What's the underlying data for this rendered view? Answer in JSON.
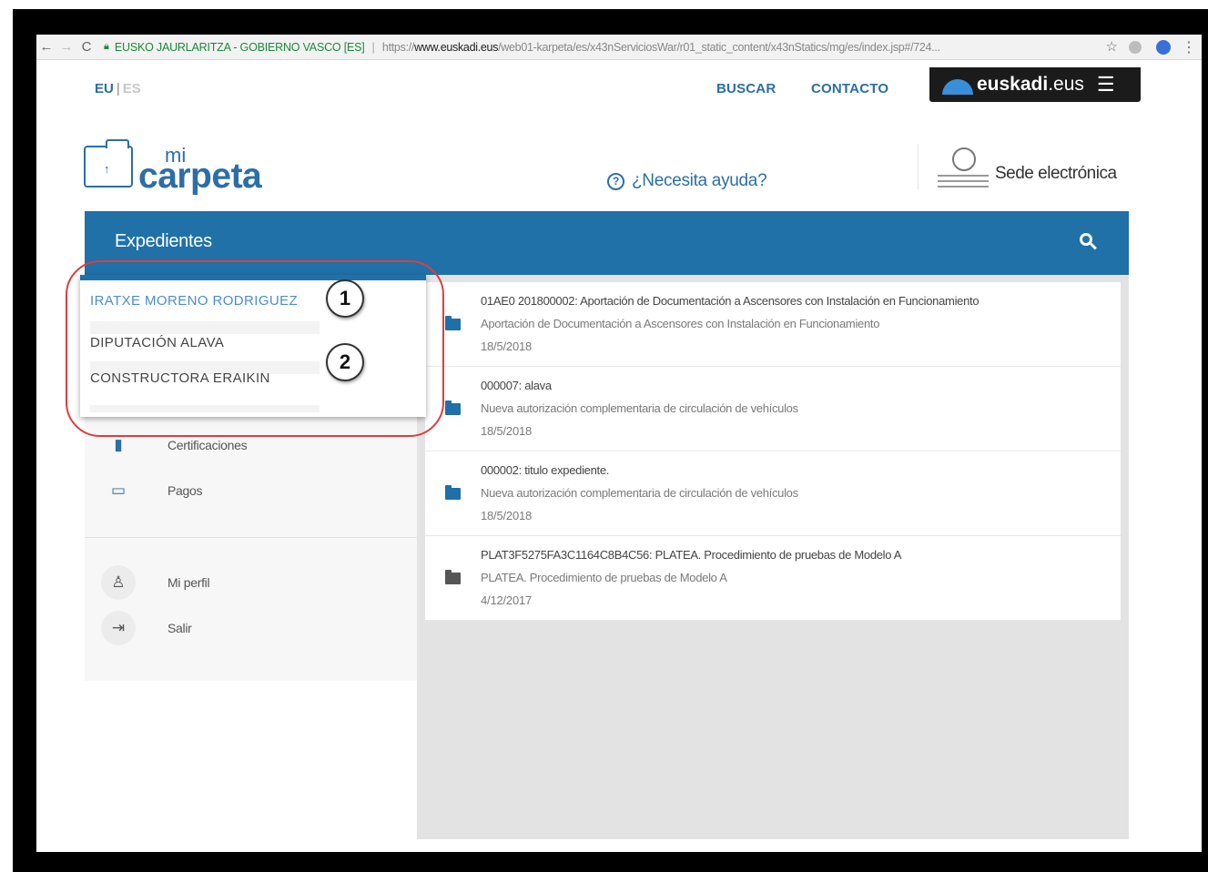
{
  "browser": {
    "back": "←",
    "forward": "→",
    "reload": "C",
    "site_name": "EUSKO JAURLARITZA - GOBIERNO VASCO [ES]",
    "url_prefix": "https://",
    "url_host": "www.euskadi.eus",
    "url_path": "/web01-karpeta/es/x43nServiciosWar/r01_static_content/x43nStatics/mg/es/index.jsp#/724...",
    "star": "☆",
    "menu": "⋮"
  },
  "header": {
    "lang_eu": "EU",
    "lang_sep": "|",
    "lang_es": "ES",
    "buscar": "BUSCAR",
    "contacto": "CONTACTO",
    "portal_bold": "euskadi",
    "portal_rest": ".eus",
    "portal_menu": "☰",
    "logo_mi": "mi",
    "logo_carpeta": "carpeta",
    "logo_key": "↑",
    "help_q": "?",
    "help": "¿Necesita ayuda?",
    "sede": "Sede electrónica"
  },
  "bluebar": {
    "title": "Expedientes"
  },
  "sidebar": {
    "items": [
      {
        "icon": "▮",
        "label": "Certificaciones"
      },
      {
        "icon": "▭",
        "label": "Pagos"
      },
      {
        "icon": "♙",
        "label": "Mi perfil"
      },
      {
        "icon": "⇥",
        "label": "Salir"
      }
    ]
  },
  "popup": {
    "options": [
      "IRATXE MORENO RODRIGUEZ",
      "DIPUTACIÓN ALAVA",
      "CONSTRUCTORA ERAIKIN"
    ]
  },
  "badges": [
    "1",
    "2"
  ],
  "expedientes": [
    {
      "title": "01AE0 201800002: Aportación de Documentación a Ascensores con Instalación en Funcionamiento",
      "subtitle": "Aportación de Documentación a Ascensores con Instalación en Funcionamiento",
      "date": "18/5/2018"
    },
    {
      "title": "000007: alava",
      "subtitle": "Nueva autorización complementaria de circulación de vehículos",
      "date": "18/5/2018"
    },
    {
      "title": "000002: titulo expediente.",
      "subtitle": "Nueva autorización complementaria de circulación de vehículos",
      "date": "18/5/2018"
    },
    {
      "title": "PLAT3F5275FA3C1164C8B4C56: PLATEA. Procedimiento de pruebas de Modelo A",
      "subtitle": "PLATEA. Procedimiento de pruebas de Modelo A",
      "date": "4/12/2017"
    }
  ],
  "colors": {
    "brand_blue": "#1f71a8",
    "selected_option": "#4a8dcf",
    "callout_red": "#e23b3b"
  }
}
